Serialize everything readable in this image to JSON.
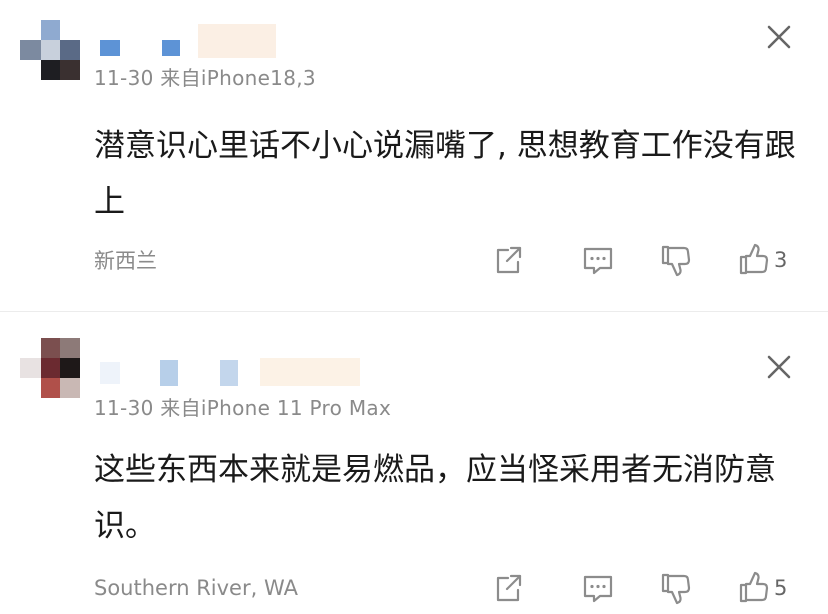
{
  "comments": [
    {
      "meta": "11-30  来自iPhone18,3",
      "text": "潜意识心里话不小心说漏嘴了, 思想教育工作没有跟上",
      "location": "新西兰",
      "like_count": "3",
      "icons": [
        "share-icon",
        "reply-icon",
        "dislike-icon",
        "like-icon",
        "close-icon"
      ]
    },
    {
      "meta": "11-30  来自iPhone 11 Pro Max",
      "text": "这些东西本来就是易燃品，应当怪采用者无消防意识。",
      "location": "Southern River, WA",
      "like_count": "5",
      "icons": [
        "share-icon",
        "reply-icon",
        "dislike-icon",
        "like-icon",
        "close-icon"
      ]
    }
  ],
  "colors": {
    "meta_gray": "#8a8a8a",
    "icon_gray": "#8c8c8c",
    "divider": "#ececec"
  }
}
